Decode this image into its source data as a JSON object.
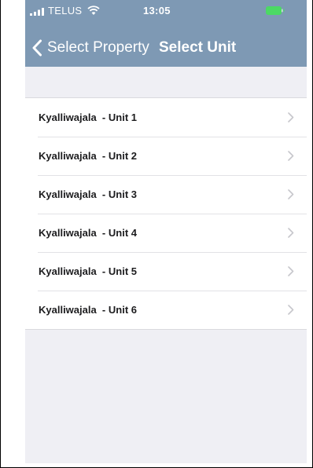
{
  "status_bar": {
    "carrier": "TELUS",
    "time": "13:05",
    "signal_icon": "signal-bars-icon",
    "wifi_icon": "wifi-icon",
    "battery_icon": "battery-charging-icon",
    "battery_color": "#4cd964"
  },
  "navbar": {
    "back_label": "Select Property",
    "back_icon": "chevron-left-icon",
    "title": "Select Unit",
    "background": "#7e99b4"
  },
  "units": [
    {
      "label": "Kyalliwajala  - Unit 1"
    },
    {
      "label": "Kyalliwajala  - Unit 2"
    },
    {
      "label": "Kyalliwajala  - Unit 3"
    },
    {
      "label": "Kyalliwajala  - Unit 4"
    },
    {
      "label": "Kyalliwajala  - Unit 5"
    },
    {
      "label": "Kyalliwajala  - Unit 6"
    }
  ],
  "row_disclosure_icon": "chevron-right-icon"
}
